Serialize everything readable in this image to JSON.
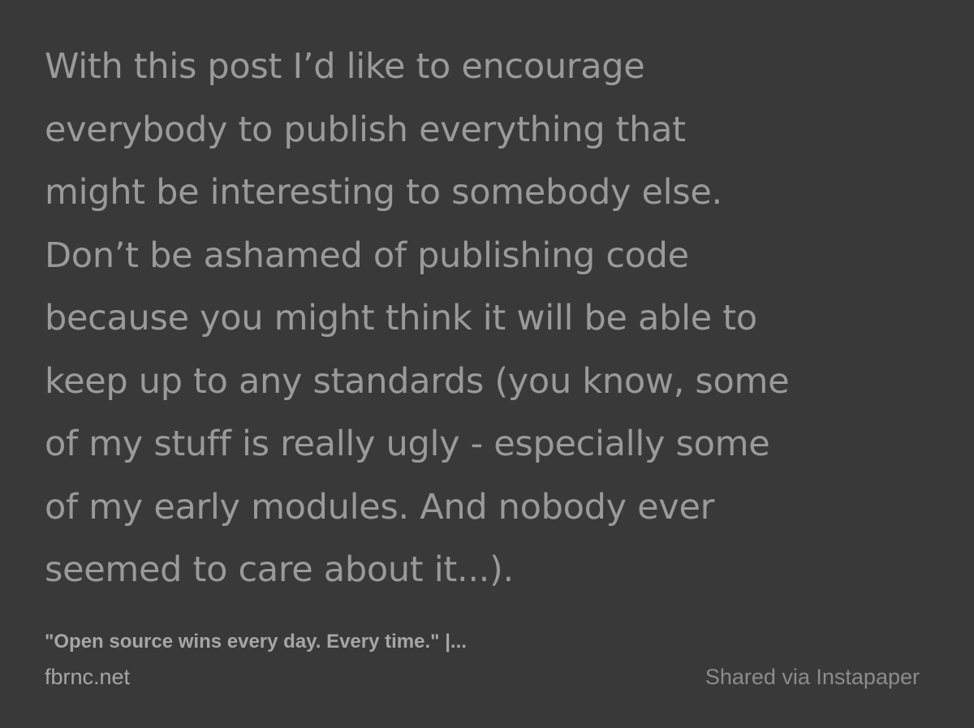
{
  "colors": {
    "background": "#393939",
    "quote_text": "#9a9a9a",
    "source_text": "#a6a6a6",
    "shared_text": "#8c8c8c"
  },
  "quote": {
    "lines": [
      "With this post I’d like to encourage",
      "everybody to publish everything that",
      "might be interesting to somebody else.",
      "Don’t be ashamed of publishing code",
      "because you might think it will be able to",
      "keep up to any standards (you know, some",
      "of my stuff is really ugly - especially some",
      "of my early modules. And nobody ever",
      "seemed to care about it...)."
    ]
  },
  "source": {
    "title": "\"Open source wins every day. Every time.\" |...",
    "domain": "fbrnc.net"
  },
  "footer": {
    "shared_via": "Shared via Instapaper"
  }
}
